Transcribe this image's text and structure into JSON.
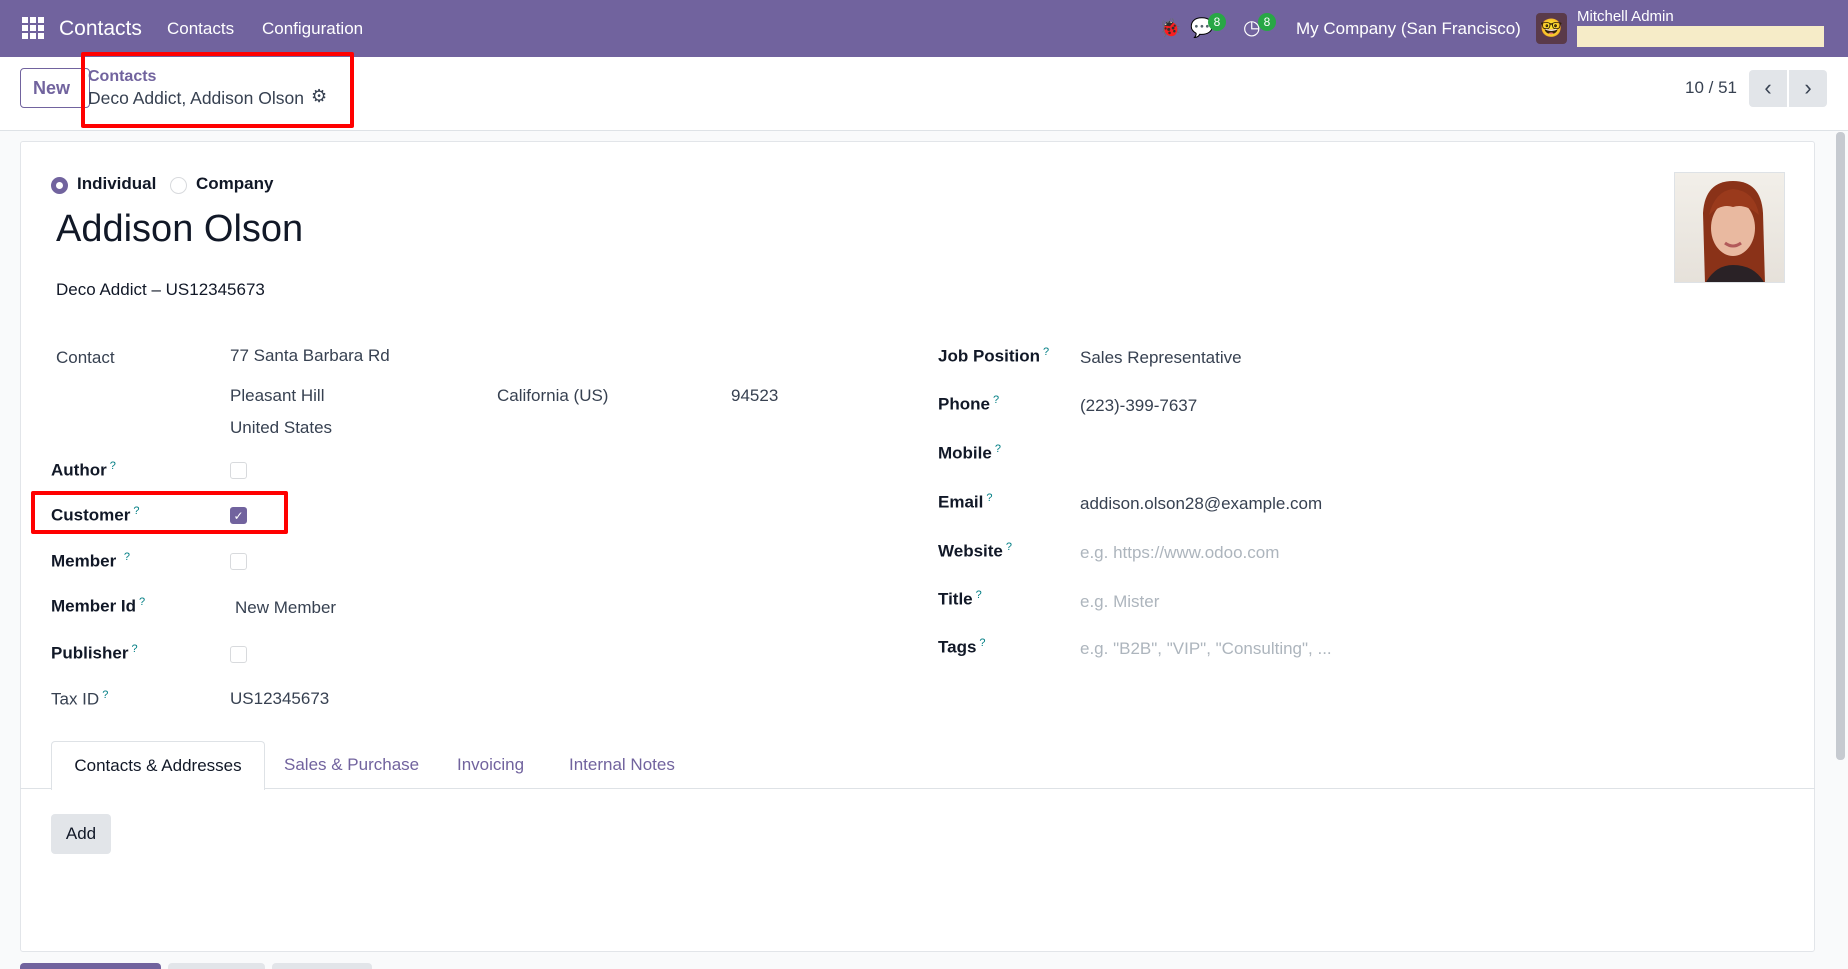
{
  "navbar": {
    "app_name": "Contacts",
    "menu": [
      "Contacts",
      "Configuration"
    ],
    "messages_count": "8",
    "activities_count": "8",
    "company": "My Company (San Francisco)",
    "user": "Mitchell Admin"
  },
  "control_panel": {
    "new_label": "New",
    "breadcrumb_parent": "Contacts",
    "record_name": "Deco Addict, Addison Olson",
    "pager": "10 / 51"
  },
  "form": {
    "type_options": [
      "Individual",
      "Company"
    ],
    "type_selected": "Individual",
    "name": "Addison Olson",
    "company_line": "Deco Addict – US12345673",
    "contact_label": "Contact",
    "address": {
      "street": "77 Santa Barbara Rd",
      "city": "Pleasant Hill",
      "state": "California (US)",
      "zip": "94523",
      "country": "United States"
    },
    "left_fields": {
      "author": {
        "label": "Author",
        "checked": false
      },
      "customer": {
        "label": "Customer",
        "checked": true
      },
      "member": {
        "label": "Member",
        "checked": false
      },
      "member_id": {
        "label": "Member Id",
        "value": "New Member"
      },
      "publisher": {
        "label": "Publisher",
        "checked": false
      },
      "tax_id": {
        "label": "Tax ID",
        "value": "US12345673"
      }
    },
    "right_fields": {
      "job_position": {
        "label": "Job Position",
        "value": "Sales Representative"
      },
      "phone": {
        "label": "Phone",
        "value": "(223)-399-7637"
      },
      "mobile": {
        "label": "Mobile",
        "value": ""
      },
      "email": {
        "label": "Email",
        "value": "addison.olson28@example.com"
      },
      "website": {
        "label": "Website",
        "placeholder": "e.g. https://www.odoo.com"
      },
      "title": {
        "label": "Title",
        "placeholder": "e.g. Mister"
      },
      "tags": {
        "label": "Tags",
        "placeholder": "e.g. \"B2B\", \"VIP\", \"Consulting\", ..."
      }
    },
    "help_marker": "?"
  },
  "tabs": [
    "Contacts & Addresses",
    "Sales & Purchase",
    "Invoicing",
    "Internal Notes"
  ],
  "active_tab": "Contacts & Addresses",
  "add_label": "Add",
  "colors": {
    "brand": "#71639e",
    "highlight": "#ff0000"
  }
}
